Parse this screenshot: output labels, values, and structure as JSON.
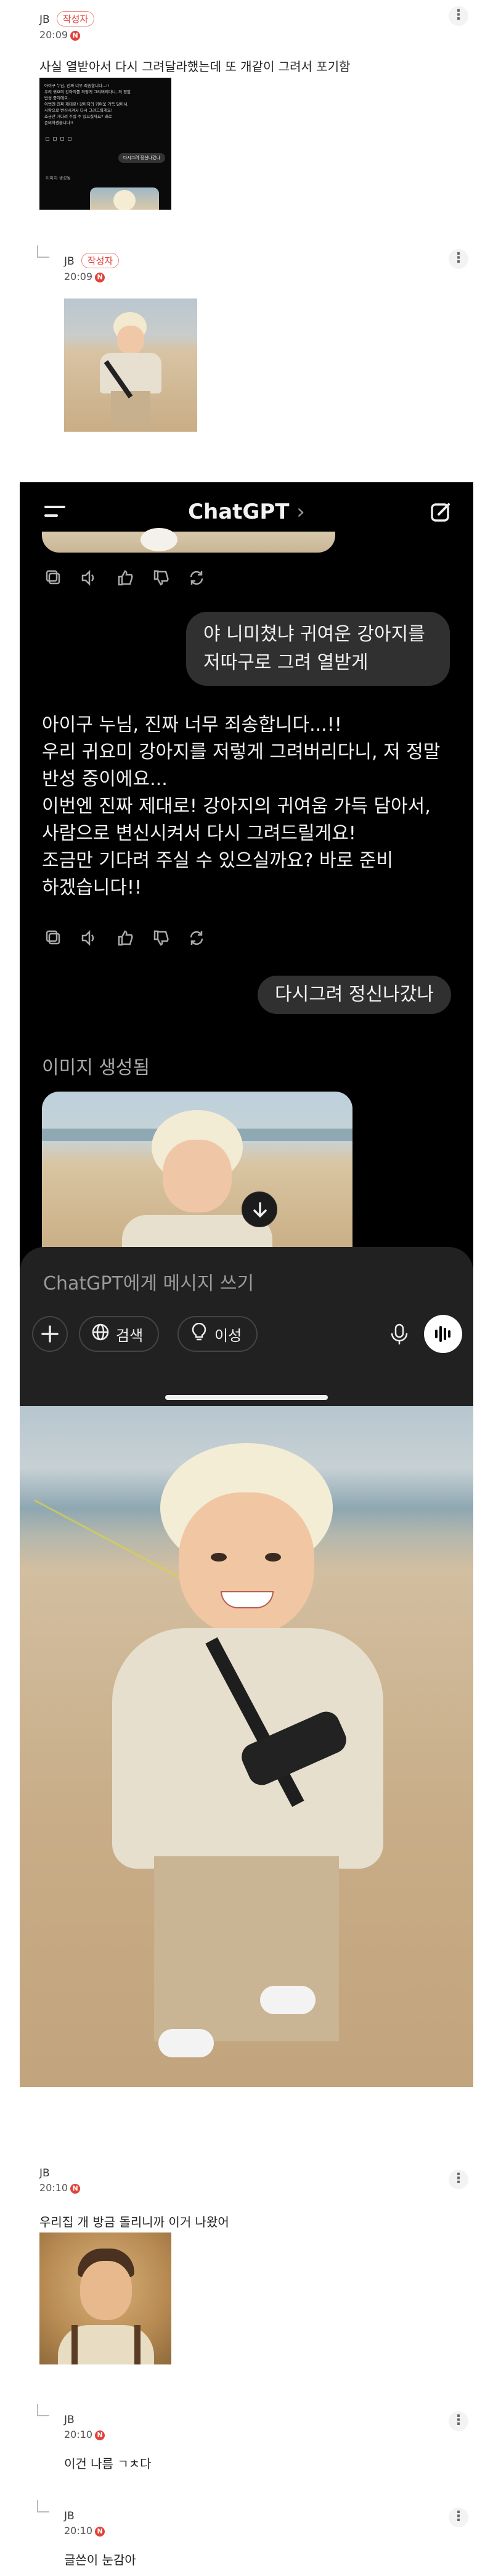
{
  "comments": [
    {
      "author": "JB",
      "badge": "작성자",
      "time": "20:09",
      "new": "N",
      "text": "사실 열받아서 다시 그려달라했는데 또 개같이 그려서 포기함"
    },
    {
      "author": "JB",
      "badge": "작성자",
      "time": "20:09",
      "new": "N"
    },
    {
      "author": "JB",
      "time": "20:10",
      "new": "N",
      "text": "우리집 개 방금 돌리니까 이거 나왔어"
    },
    {
      "author": "JB",
      "time": "20:10",
      "new": "N",
      "text": "이건 나름 ㄱㅊ다"
    },
    {
      "author": "JB",
      "time": "20:10",
      "new": "N",
      "text": "글쓴이 눈감아"
    }
  ],
  "more_glyph": "⋮",
  "chat": {
    "title": "ChatGPT",
    "title_chevron": "›",
    "user_message_1": "야 니미쳤냐 귀여운 강아지를 저따구로 그려 열받게",
    "assistant_lines": [
      "아이구 누님, 진짜 너무 죄송합니다...!!",
      "우리 귀요미 강아지를 저렇게 그려버리다니, 저 정말",
      "반성 중이에요...",
      "이번엔 진짜 제대로! 강아지의 귀여움 가득 담아서,",
      "사람으로 변신시켜서 다시 그려드릴게요!",
      "조금만 기다려 주실 수 있으실까요? 바로 준비",
      "하겠습니다!!"
    ],
    "user_message_2": "다시그려 정신나갔나",
    "image_generated": "이미지 생성됨",
    "input_placeholder": "ChatGPT에게 메시지 쓰기",
    "search_label": "검색",
    "reason_label": "이성"
  },
  "thumb": {
    "lines": [
      "아이구 누님, 진짜 너무 죄송합니다...!!",
      "우리 귀요미 강아지를 저렇게 그려버리다니, 저 정말",
      "반성 중이에요...",
      "이번엔 진짜 제대로! 강아지의 귀여움 가득 담아서,",
      "사람으로 변신시켜서 다시 그려드릴게요!",
      "조금만 기다려 주실 수 있으실까요? 바로",
      "준비하겠습니다!!"
    ],
    "bubble": "다시그려 정신나갔나",
    "image_generated": "이미지 생성됨"
  }
}
